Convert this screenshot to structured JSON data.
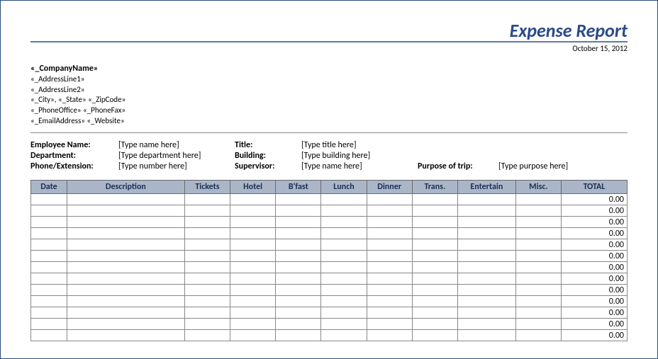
{
  "header": {
    "title": "Expense Report",
    "date": "October 15, 2012"
  },
  "company": {
    "name": "«_CompanyName»",
    "address1": "«_AddressLine1»",
    "address2": "«_AddressLine2»",
    "city_state_zip": "«_City», «_State»  «_ZipCode»",
    "phone_fax": "«_PhoneOffice» «_PhoneFax»",
    "email_web": "«_EmailAddress» «_Website»"
  },
  "info": {
    "employee_name_label": "Employee Name:",
    "employee_name_value": "[Type name here]",
    "title_label": "Title:",
    "title_value": "[Type title here]",
    "department_label": "Department:",
    "department_value": "[Type department here]",
    "building_label": "Building:",
    "building_value": "[Type building here]",
    "phone_label": "Phone/Extension:",
    "phone_value": "[Type number here]",
    "supervisor_label": "Supervisor:",
    "supervisor_value": "[Type name here]",
    "purpose_label": "Purpose of trip:",
    "purpose_value": "[Type purpose here]"
  },
  "table": {
    "headers": {
      "date": "Date",
      "description": "Description",
      "tickets": "Tickets",
      "hotel": "Hotel",
      "bfast": "B'fast",
      "lunch": "Lunch",
      "dinner": "Dinner",
      "trans": "Trans.",
      "entertain": "Entertain",
      "misc": "Misc.",
      "total": "TOTAL"
    },
    "rows": [
      {
        "total": "0.00"
      },
      {
        "total": "0.00"
      },
      {
        "total": "0.00"
      },
      {
        "total": "0.00"
      },
      {
        "total": "0.00"
      },
      {
        "total": "0.00"
      },
      {
        "total": "0.00"
      },
      {
        "total": "0.00"
      },
      {
        "total": "0.00"
      },
      {
        "total": "0.00"
      },
      {
        "total": "0.00"
      },
      {
        "total": "0.00"
      },
      {
        "total": "0.00"
      }
    ]
  }
}
